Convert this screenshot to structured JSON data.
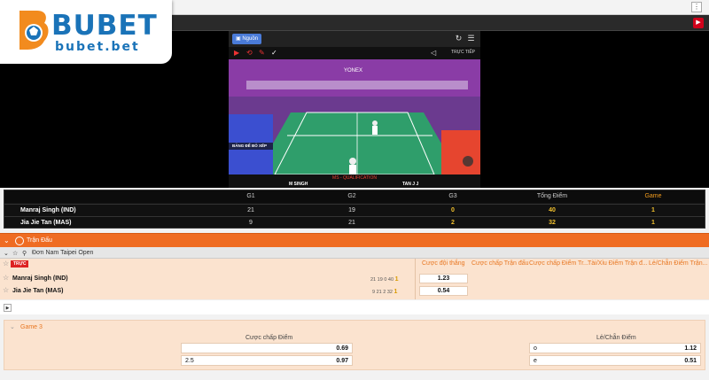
{
  "brand": {
    "name": "BUBET",
    "domain": "bubet.bet",
    "color": "#1a73b8"
  },
  "player": {
    "source_button": "Nguồn",
    "live_label": "TRỰC TIẾP",
    "overlay_label": "BẢNG ĐỂ BỎ XẾP",
    "video_caption": "MS - QUALIFICATION",
    "left_player_short": "M SINGH",
    "right_player_short": "TAN J J",
    "sponsor": "YONEX"
  },
  "score_table": {
    "headers": [
      "G1",
      "G2",
      "G3",
      "Tổng Điểm",
      "Game"
    ],
    "rows": [
      {
        "name": "Manraj Singh (IND)",
        "g1": "21",
        "g2": "19",
        "g3": "0",
        "total": "40",
        "game": "1"
      },
      {
        "name": "Jia Jie Tan (MAS)",
        "g1": "9",
        "g2": "21",
        "g3": "2",
        "total": "32",
        "game": "1"
      }
    ]
  },
  "section": {
    "title": "Trận Đấu"
  },
  "league": {
    "name": "Đơn Nam Taipei Open"
  },
  "match": {
    "live_badge": "TRỰC",
    "columns": [
      "Cược đội thắng",
      "Cược chấp Trận đấu",
      "Cược chấp Điểm Tr...",
      "Tài/Xỉu Điểm Trận đ...",
      "Lẻ/Chẵn Điểm Trận..."
    ],
    "teams": [
      {
        "name": "Manraj Singh (IND)",
        "s1": "21",
        "s2": "19",
        "s3": "0",
        "total": "40",
        "game": "1",
        "odd": "1.23"
      },
      {
        "name": "Jia Jie Tan (MAS)",
        "s1": "9",
        "s2": "21",
        "s3": "2",
        "total": "32",
        "game": "1",
        "odd": "0.54"
      }
    ]
  },
  "game_panel": {
    "title": "Game 3",
    "handicap": {
      "title": "Cược chấp Điểm",
      "rows": [
        {
          "label": "",
          "odd": "0.69"
        },
        {
          "label": "2.5",
          "odd": "0.97"
        }
      ]
    },
    "odd_even": {
      "title": "Lẻ/Chẵn Điểm",
      "rows": [
        {
          "label": "o",
          "odd": "1.12"
        },
        {
          "label": "e",
          "odd": "0.51"
        }
      ]
    }
  },
  "colors": {
    "accent": "#ef6c22",
    "live": "#d22222",
    "highlight": "#f2c12e",
    "panel": "#fbe3cf"
  }
}
